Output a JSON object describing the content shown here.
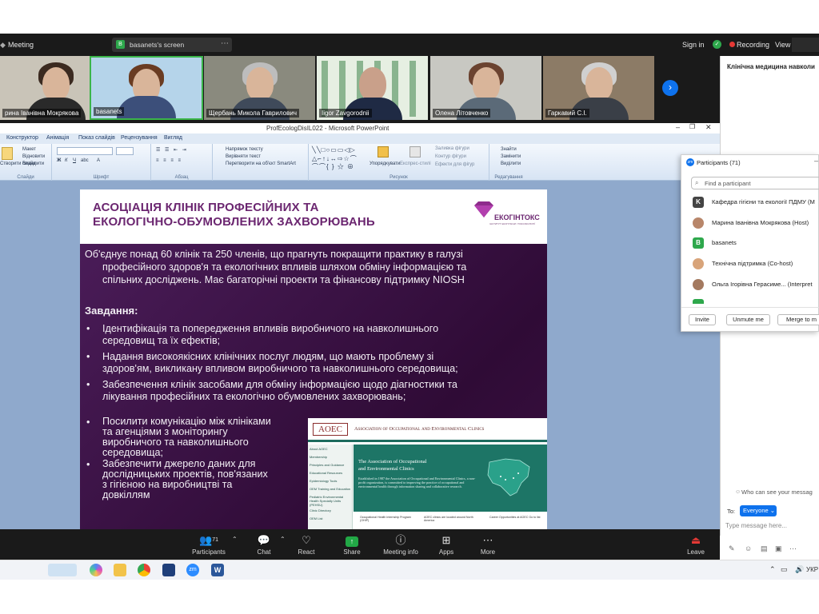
{
  "zoom_topbar": {
    "meeting_label": "Meeting",
    "screen_share_label": "basanets's screen",
    "sign_in": "Sign in",
    "recording": "Recording",
    "view": "View"
  },
  "video_tiles": [
    {
      "name": "рина Іванівна Мокрякова"
    },
    {
      "name": "basanets"
    },
    {
      "name": "Щербань Микола Гаврилович"
    },
    {
      "name": "Iigor Zavgorodnii"
    },
    {
      "name": "Олена Літовченко"
    },
    {
      "name": "Гаркавий С.І."
    }
  ],
  "chat_panel_title": "Клінічна медицина навколи",
  "powerpoint": {
    "window_title": "ProfEcologDisIL022 - Microsoft PowerPoint",
    "menu": [
      "Конструктор",
      "Анімація",
      "Показ слайдів",
      "Рецензування",
      "Вигляд"
    ],
    "ribbon": {
      "slides_group": "Слайди",
      "create_slide": "Створити слайд",
      "maket": "Макет",
      "vidnovyty": "Відновити",
      "vydalyty": "Видалити",
      "font_group": "Шрифт",
      "paragraph_group": "Абзац",
      "text_direction": "Напрямок тексту",
      "align_text": "Вирівняти текст",
      "convert_smartart": "Перетворити на об'єкт SmartArt",
      "drawing_group": "Рисунок",
      "arrange": "Упорядкувати",
      "express_styles": "Експрес-стилі",
      "fill": "Заливка фігури",
      "outline": "Контур фігури",
      "effects": "Ефекти для фігур",
      "find": "Знайти",
      "replace": "Замінити",
      "select": "Виділити",
      "edit_group": "Редагування"
    }
  },
  "slide": {
    "title_line1": "АСОЦІАЦІЯ КЛІНІК ПРОФЕСІЙНИХ ТА",
    "title_line2": "ЕКОЛОГІЧНО-ОБУМОВЛЕНИХ ЗАХВОРЮВАНЬ",
    "logo_text": "ЕКОГІНТОКС",
    "logo_sub": "ІНСТИТУТ ЕКОГІГІЄНИ І ТОКСИКОЛОГІЇ",
    "intro_line1": "Об'єднує понад 60 клінік та 250 членів, що прагнуть покращити практику в галузі",
    "intro_line2": "професійного здоров'я та екологічних впливів шляхом обміну інформацією та",
    "intro_line3": "спільних досліджень. Має багаторічні проекти та фінансову підтримку NIOSH",
    "tasks_heading": "Завдання:",
    "bullets": [
      {
        "l1": "Ідентифікація та попередження впливів виробничого на навколишнього",
        "l2": "середовищ та їх ефектів;"
      },
      {
        "l1": "Надання високоякісних клінічних послуг людям, що мають проблему зі",
        "l2": "здоров'ям, викликану впливом виробничого та навколишнього середовища;"
      },
      {
        "l1": "Забезпечення клінік засобами для обміну інформацією щодо діагностики та",
        "l2": "лікування професійних та екологічно обумовлених захворювань;"
      }
    ],
    "bullets2": [
      {
        "l1": "Посилити комунікацію між клініками",
        "l2": "та агенціями з моніторингу",
        "l3": "виробничого та навколишнього",
        "l4": "середовища;"
      },
      {
        "l1": "Забезпечити джерело даних для",
        "l2": "дослідницьких проектів, пов'язаних",
        "l3": "з гігієною на виробництві та",
        "l4": "довкіллям"
      }
    ],
    "aoec": {
      "logo": "AOEC",
      "header": "Association of Occupational and Environmental Clinics",
      "heading1": "The Association of Occupational",
      "heading2": "and Environmental Clinics",
      "para": "Established in 1987 the Association of Occupational and Environmental Clinics, a non-profit organization, is committed to improving the practice of occupational and environmental health through information sharing and collaborative research.",
      "nav": [
        "About AOEC",
        "Membership",
        "Principles and Guidance",
        "Educational Resources",
        "Epidemiology Tools",
        "OEM Training and Education",
        "Pediatric Environmental Health Specialty Units (PEHSU)",
        "Clinic Directory",
        "OEM List"
      ],
      "foot1": "Occupational Health Internship Program (OHIP)",
      "foot2": "AOEC clinics are located around North America",
      "foot3": "Career Opportunities at AOEC Go to list"
    }
  },
  "participants": {
    "title": "Participants (71)",
    "search_placeholder": "Find a participant",
    "list": [
      {
        "initial": "K",
        "name": "Кафедра гігієни та екології ПДМУ (M"
      },
      {
        "initial": "",
        "name": "Марина Іванівна Мокрякова (Host)"
      },
      {
        "initial": "B",
        "name": "basanets"
      },
      {
        "initial": "",
        "name": "Технічна підтримка (Co-host)"
      },
      {
        "initial": "",
        "name": "Ольга Ігорівна Герасиме... (Interpret"
      }
    ],
    "invite": "Invite",
    "unmute": "Unmute me",
    "merge": "Merge to m"
  },
  "chat": {
    "who_can_see": "Who can see your messag",
    "to_label": "To:",
    "everyone": "Everyone",
    "placeholder": "Type message here..."
  },
  "toolbar": {
    "participants_count": "71",
    "participants": "Participants",
    "chat": "Chat",
    "react": "React",
    "share": "Share",
    "meeting_info": "Meeting info",
    "apps": "Apps",
    "more": "More",
    "leave": "Leave"
  },
  "taskbar": {
    "lang": "УКР"
  }
}
